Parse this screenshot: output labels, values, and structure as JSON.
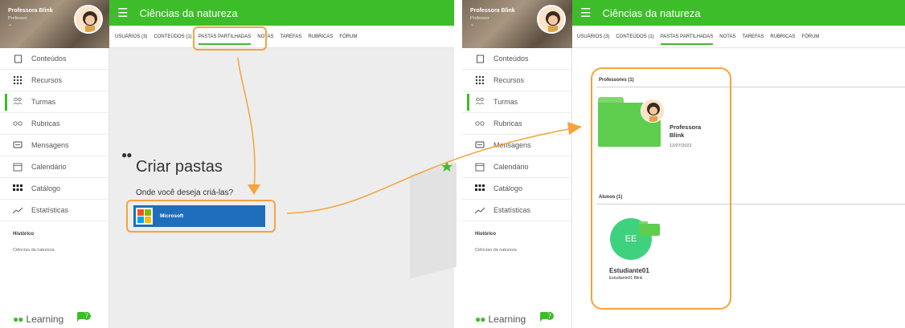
{
  "user": {
    "name": "Professora Blink",
    "role": "Professor",
    "caret": "⌄"
  },
  "course_title": "Ciências da natureza",
  "tabs": [
    "USUÁRIOS (3)",
    "CONTEÚDOS (1)",
    "PASTAS PARTILHADAS",
    "NOTAS",
    "TAREFAS",
    "RUBRICAS",
    "FÓRUM"
  ],
  "active_tab": "PASTAS PARTILHADAS",
  "nav": {
    "items": [
      {
        "label": "Conteúdos",
        "icon": "document-icon"
      },
      {
        "label": "Recursos",
        "icon": "grid-dots-icon"
      },
      {
        "label": "Turmas",
        "icon": "group-icon"
      },
      {
        "label": "Rubricas",
        "icon": "glasses-icon"
      },
      {
        "label": "Mensagens",
        "icon": "chat-icon"
      },
      {
        "label": "Calendário",
        "icon": "calendar-icon"
      },
      {
        "label": "Catálogo",
        "icon": "catalog-icon"
      },
      {
        "label": "Estatísticas",
        "icon": "chart-line-icon"
      }
    ],
    "active": "Turmas"
  },
  "history": {
    "title": "Histórico",
    "item": "Ciências da natureza"
  },
  "brand": {
    "dots": "●●",
    "text": "Learning",
    "chat_count": "7"
  },
  "left_panel": {
    "dots": "●●",
    "title": "Criar pastas",
    "question": "Onde você deseja criá-las?",
    "provider_button": "Microsoft"
  },
  "right_panel": {
    "teachers_label": "Professores (1)",
    "teacher_name_line1": "Professora",
    "teacher_name_line2": "Blink",
    "teacher_date": "12/07/2022",
    "students_label": "Alunos (1)",
    "student_initials": "EE",
    "student_name": "Estudiante01",
    "student_sub": "Estudiante01 Blink"
  },
  "colors": {
    "brand_green": "#3dbd2a",
    "annotation_orange": "#f5a33c",
    "microsoft_blue": "#1f6ebc"
  }
}
